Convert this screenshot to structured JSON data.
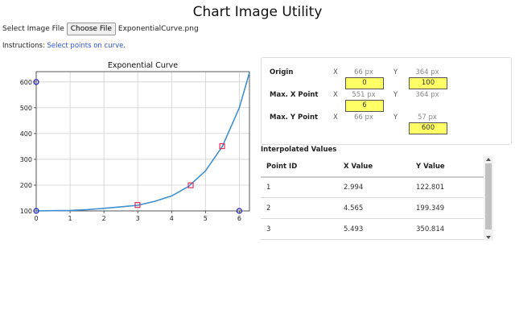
{
  "page_title": "Chart Image Utility",
  "file": {
    "label": "Select Image File",
    "button": "Choose File",
    "filename": "ExponentialCurve.png"
  },
  "instructions": {
    "label": "Instructions:",
    "text": "Select points on curve."
  },
  "chart_data": {
    "type": "line",
    "title": "Exponential Curve",
    "xlabel": "",
    "ylabel": "",
    "xlim": [
      0,
      6.3
    ],
    "ylim": [
      100,
      640
    ],
    "xticks": [
      0,
      1,
      2,
      3,
      4,
      5,
      6
    ],
    "yticks": [
      100,
      200,
      300,
      400,
      500,
      600
    ],
    "grid": true,
    "series": [
      {
        "x": [
          0,
          0.5,
          1,
          1.5,
          2,
          2.5,
          3,
          3.5,
          4,
          4.5,
          5,
          5.5,
          6,
          6.3
        ],
        "y": [
          100,
          101,
          102,
          105,
          110,
          116,
          122,
          137,
          158,
          195,
          255,
          350,
          500,
          636
        ]
      }
    ],
    "markers": [
      {
        "x": 0,
        "y": 600,
        "kind": "calibration"
      },
      {
        "x": 0,
        "y": 100,
        "kind": "calibration"
      },
      {
        "x": 6,
        "y": 100,
        "kind": "calibration"
      },
      {
        "x": 2.994,
        "y": 122.801,
        "kind": "selected"
      },
      {
        "x": 4.565,
        "y": 199.349,
        "kind": "selected"
      },
      {
        "x": 5.493,
        "y": 350.814,
        "kind": "selected"
      }
    ],
    "colors": {
      "line": "#3d8fd1",
      "calibration": "#1a1acc",
      "selected": "#e0204a"
    }
  },
  "calibration": {
    "x_axis": "X",
    "y_axis": "Y",
    "origin": {
      "label": "Origin",
      "x_px": "66 px",
      "y_px": "364 px",
      "x_value": "0",
      "y_value": "100"
    },
    "max_x": {
      "label": "Max. X Point",
      "x_px": "551 px",
      "y_px": "364 px",
      "x_value": "6"
    },
    "max_y": {
      "label": "Max. Y Point",
      "x_px": "66 px",
      "y_px": "57 px",
      "y_value": "600"
    }
  },
  "interpolated": {
    "title": "Interpolated Values",
    "headers": [
      "Point ID",
      "X Value",
      "Y Value"
    ],
    "rows": [
      [
        "1",
        "2.994",
        "122.801"
      ],
      [
        "2",
        "4.565",
        "199.349"
      ],
      [
        "3",
        "5.493",
        "350.814"
      ]
    ]
  }
}
